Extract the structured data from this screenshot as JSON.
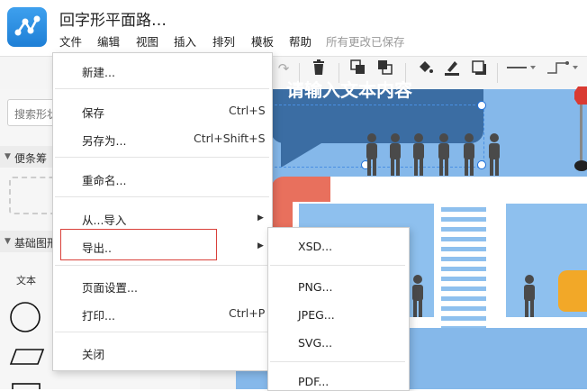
{
  "app": {
    "title": "回字形平面路…",
    "menu": [
      "文件",
      "编辑",
      "视图",
      "插入",
      "排列",
      "模板",
      "帮助"
    ],
    "save_status": "所有更改已保存"
  },
  "left_panel": {
    "search_placeholder": "搜索形状",
    "sections": [
      {
        "label": "便条筹"
      },
      {
        "label": "基础图形"
      }
    ],
    "shape_text_label": "文本"
  },
  "canvas": {
    "bubble_text": "请输入文本内容"
  },
  "file_menu": {
    "items": [
      {
        "label": "新建...",
        "shortcut": ""
      },
      {
        "label": "保存",
        "shortcut": "Ctrl+S"
      },
      {
        "label": "另存为...",
        "shortcut": "Ctrl+Shift+S"
      },
      {
        "label": "重命名...",
        "shortcut": ""
      },
      {
        "label": "从...导入",
        "shortcut": ""
      },
      {
        "label": "导出..",
        "shortcut": ""
      },
      {
        "label": "页面设置...",
        "shortcut": ""
      },
      {
        "label": "打印...",
        "shortcut": "Ctrl+P"
      },
      {
        "label": "关闭",
        "shortcut": ""
      }
    ]
  },
  "export_submenu": {
    "items": [
      "XSD...",
      "PNG...",
      "JPEG...",
      "SVG...",
      "PDF..."
    ]
  },
  "colors": {
    "accent": "#1e7fd6",
    "highlight_border": "#d9403a",
    "canvas_blue": "#85b8ea",
    "bubble": "#3b6da3"
  }
}
